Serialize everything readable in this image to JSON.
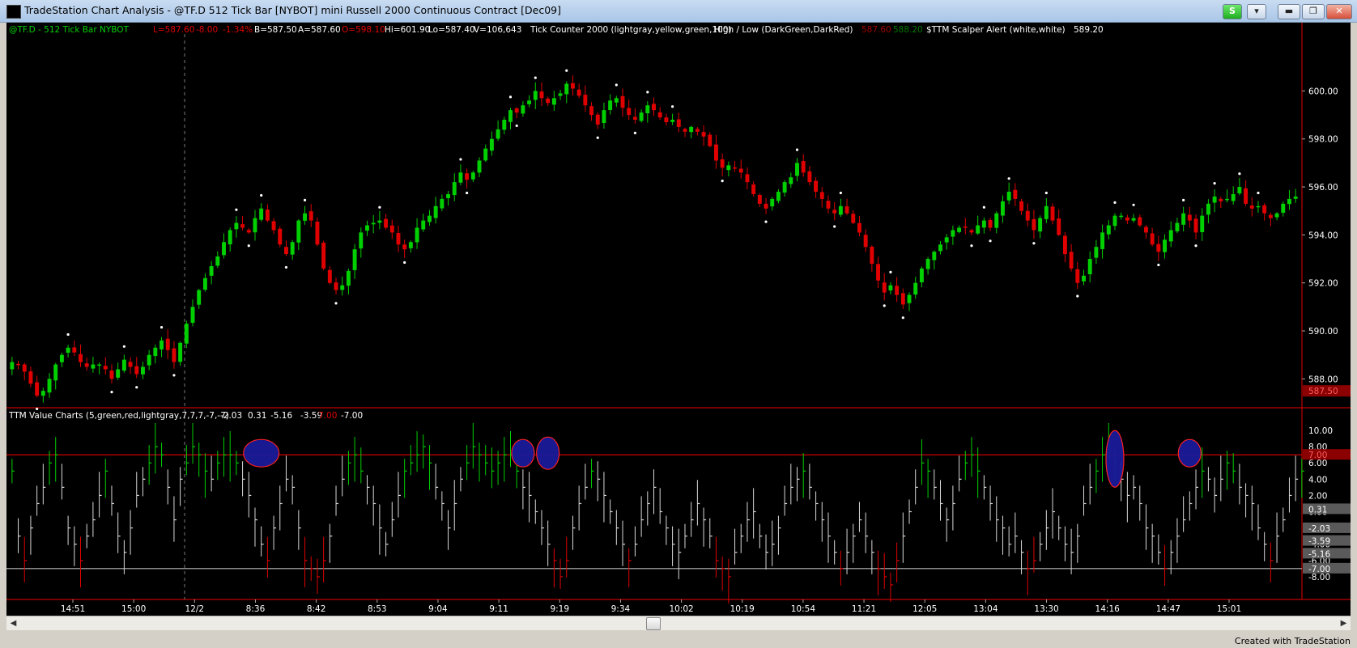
{
  "window": {
    "title": "TradeStation Chart Analysis - @TF.D 512 Tick Bar [NYBOT] mini Russell 2000 Continuous Contract [Dec09]",
    "buttons": {
      "s_label": "S",
      "minimize_label": "▬",
      "restore_label": "❐",
      "close_label": "✕"
    },
    "app_icon": "tradestation-chart-icon"
  },
  "header": {
    "symbol": "@TF.D - 512 Tick Bar  NYBOT",
    "last": "L=587.60",
    "net": "-8.00",
    "pct": "-1.34%",
    "bid": "B=587.50",
    "ask": "A=587.60",
    "open": "O=598.10",
    "high": "Hi=601.90",
    "low": "Lo=587.40",
    "volume": "V=106,643",
    "tick_counter": "Tick Counter 2000 (lightgray,yellow,green,100)",
    "highlow": "High / Low (DarkGreen,DarkRed)",
    "hl_hi": "587.60",
    "hl_lo": "588.20",
    "scalper": "$TTM Scalper Alert (white,white)",
    "scalper_val": "589.20"
  },
  "lower_header": {
    "name": "TTM Value Charts (5,green,red,lightgray,7,7,7,-7,-7)",
    "v1": "-2.03",
    "v2": "0.31",
    "v3": "-5.16",
    "v4": "-3.59",
    "v5": "7.00",
    "v6": "-7.00"
  },
  "colors": {
    "up": "#00d000",
    "down": "#e00000",
    "white": "#ffffff",
    "circle": "#1a1a9a",
    "axis": "#c00000",
    "grid_box": "#5a5a5a"
  },
  "chart_data": {
    "type": "candlestick",
    "price_axis": {
      "ticks": [
        "600.00",
        "598.00",
        "596.00",
        "594.00",
        "592.00",
        "590.00",
        "588.00"
      ],
      "ylim": [
        587.0,
        601.7
      ],
      "last_label": "587.50"
    },
    "closes": [
      588.7,
      588.6,
      588.3,
      587.8,
      587.3,
      587.5,
      588.0,
      588.6,
      589.0,
      589.3,
      589.1,
      588.7,
      588.5,
      588.6,
      588.6,
      588.4,
      588.0,
      588.4,
      588.8,
      588.5,
      588.2,
      588.5,
      589.0,
      589.3,
      589.6,
      589.2,
      588.7,
      589.5,
      590.3,
      591.0,
      591.7,
      592.2,
      592.7,
      593.1,
      593.7,
      594.2,
      594.5,
      594.3,
      594.1,
      594.7,
      595.1,
      594.6,
      594.2,
      593.6,
      593.2,
      593.7,
      594.6,
      594.9,
      594.6,
      593.6,
      592.6,
      592.0,
      591.7,
      591.9,
      592.5,
      593.4,
      594.1,
      594.4,
      594.5,
      594.6,
      594.3,
      594.1,
      593.6,
      593.4,
      593.7,
      594.3,
      594.6,
      594.8,
      595.2,
      595.5,
      595.7,
      596.2,
      596.6,
      596.3,
      596.6,
      597.1,
      597.6,
      598.0,
      598.4,
      598.8,
      599.2,
      599.1,
      599.4,
      599.6,
      600.0,
      599.7,
      599.5,
      599.7,
      599.9,
      600.3,
      600.1,
      599.8,
      599.4,
      599.0,
      598.6,
      599.2,
      599.6,
      599.7,
      599.3,
      599.0,
      598.8,
      599.1,
      599.4,
      599.2,
      598.9,
      598.7,
      598.8,
      598.5,
      598.3,
      598.5,
      598.3,
      598.1,
      597.7,
      597.1,
      596.8,
      596.9,
      596.8,
      596.6,
      596.2,
      595.7,
      595.3,
      595.1,
      595.5,
      595.8,
      596.2,
      596.4,
      597.0,
      596.6,
      596.2,
      595.8,
      595.5,
      595.1,
      594.9,
      595.2,
      594.9,
      594.5,
      594.1,
      593.5,
      592.8,
      592.1,
      591.6,
      591.9,
      591.5,
      591.1,
      591.5,
      592.0,
      592.6,
      593.0,
      593.3,
      593.6,
      593.9,
      594.2,
      594.3,
      594.3,
      594.1,
      594.4,
      594.6,
      594.3,
      594.9,
      595.4,
      595.8,
      595.5,
      595.0,
      594.6,
      594.2,
      594.7,
      595.2,
      594.6,
      594.0,
      593.2,
      592.6,
      592.0,
      592.3,
      593.0,
      593.5,
      594.1,
      594.4,
      594.8,
      594.8,
      594.6,
      594.7,
      594.4,
      594.1,
      593.6,
      593.3,
      593.8,
      594.2,
      594.5,
      594.9,
      594.6,
      594.1,
      594.8,
      595.3,
      595.6,
      595.4,
      595.5,
      595.7,
      596.0,
      595.3,
      595.1,
      595.2,
      594.9,
      594.7,
      594.9,
      595.3,
      595.5,
      595.6
    ],
    "oscillator": {
      "ticks": [
        "10.00",
        "8.00",
        "6.00",
        "4.00",
        "2.00",
        "0.00",
        "-2.00",
        "-4.00",
        "-6.00",
        "-8.00"
      ],
      "ylim": [
        -10.5,
        11.0
      ],
      "boxed_values": [
        "7.00",
        "0.31",
        "-2.03",
        "-3.59",
        "-5.16",
        "-7.00"
      ],
      "overbought": 7.0,
      "oversold": -7.0,
      "values": [
        5,
        -3,
        -6,
        -2,
        1,
        3,
        6,
        7,
        3,
        -2,
        -4,
        -6,
        -3,
        -1,
        2,
        5,
        1,
        -3,
        -5,
        -2,
        2,
        4,
        6,
        8,
        7,
        3,
        -1,
        4,
        6,
        8,
        7,
        5,
        4,
        6,
        7,
        7,
        6,
        4,
        2,
        -1,
        -4,
        -6,
        -2,
        1,
        4,
        3,
        -2,
        -6,
        -7,
        -8,
        -6,
        -3,
        1,
        4,
        6,
        7,
        5,
        3,
        1,
        -2,
        -4,
        -1,
        2,
        5,
        6,
        7,
        8,
        6,
        3,
        1,
        -2,
        1,
        4,
        6,
        8,
        7,
        6,
        5,
        6,
        7,
        7,
        5,
        3,
        2,
        0,
        -2,
        -4,
        -6,
        -8,
        -6,
        -2,
        1,
        3,
        5,
        4,
        2,
        0,
        -2,
        -4,
        -6,
        -4,
        -1,
        1,
        3,
        0,
        -2,
        -4,
        -5,
        -3,
        -1,
        1,
        -1,
        -3,
        -6,
        -7,
        -8,
        -5,
        -3,
        -1,
        0,
        -3,
        -5,
        -4,
        -2,
        1,
        3,
        4,
        5,
        3,
        1,
        -1,
        -3,
        -5,
        -7,
        -5,
        -3,
        -1,
        -3,
        -5,
        -7,
        -8,
        -9,
        -6,
        -3,
        0,
        3,
        6,
        5,
        3,
        1,
        -1,
        1,
        4,
        6,
        7,
        5,
        3,
        1,
        -1,
        -2,
        -4,
        -3,
        -5,
        -7,
        -6,
        -4,
        -2,
        0,
        -2,
        -4,
        -5,
        -3,
        1,
        3,
        5,
        7,
        8,
        6,
        4,
        2,
        3,
        1,
        -2,
        -3,
        -5,
        -7,
        -5,
        -3,
        -1,
        1,
        3,
        5,
        4,
        2,
        4,
        6,
        5,
        3,
        2,
        1,
        -2,
        -4,
        -6,
        -3,
        -1,
        2,
        4,
        5
      ]
    },
    "highlights": [
      {
        "label": "circle-1",
        "bar": 40
      },
      {
        "label": "circle-2",
        "bar": 82
      },
      {
        "label": "circle-3",
        "bar": 86
      },
      {
        "label": "circle-4",
        "bar": 177
      },
      {
        "label": "circle-5",
        "bar": 189
      }
    ],
    "time_labels": [
      "14:51",
      "15:00",
      "12/2",
      "8:36",
      "8:42",
      "8:53",
      "9:04",
      "9:11",
      "9:19",
      "9:34",
      "10:02",
      "10:19",
      "10:54",
      "11:21",
      "12:05",
      "13:04",
      "13:30",
      "14:16",
      "14:47",
      "15:01"
    ]
  },
  "footer": {
    "credit": "Created with TradeStation"
  }
}
